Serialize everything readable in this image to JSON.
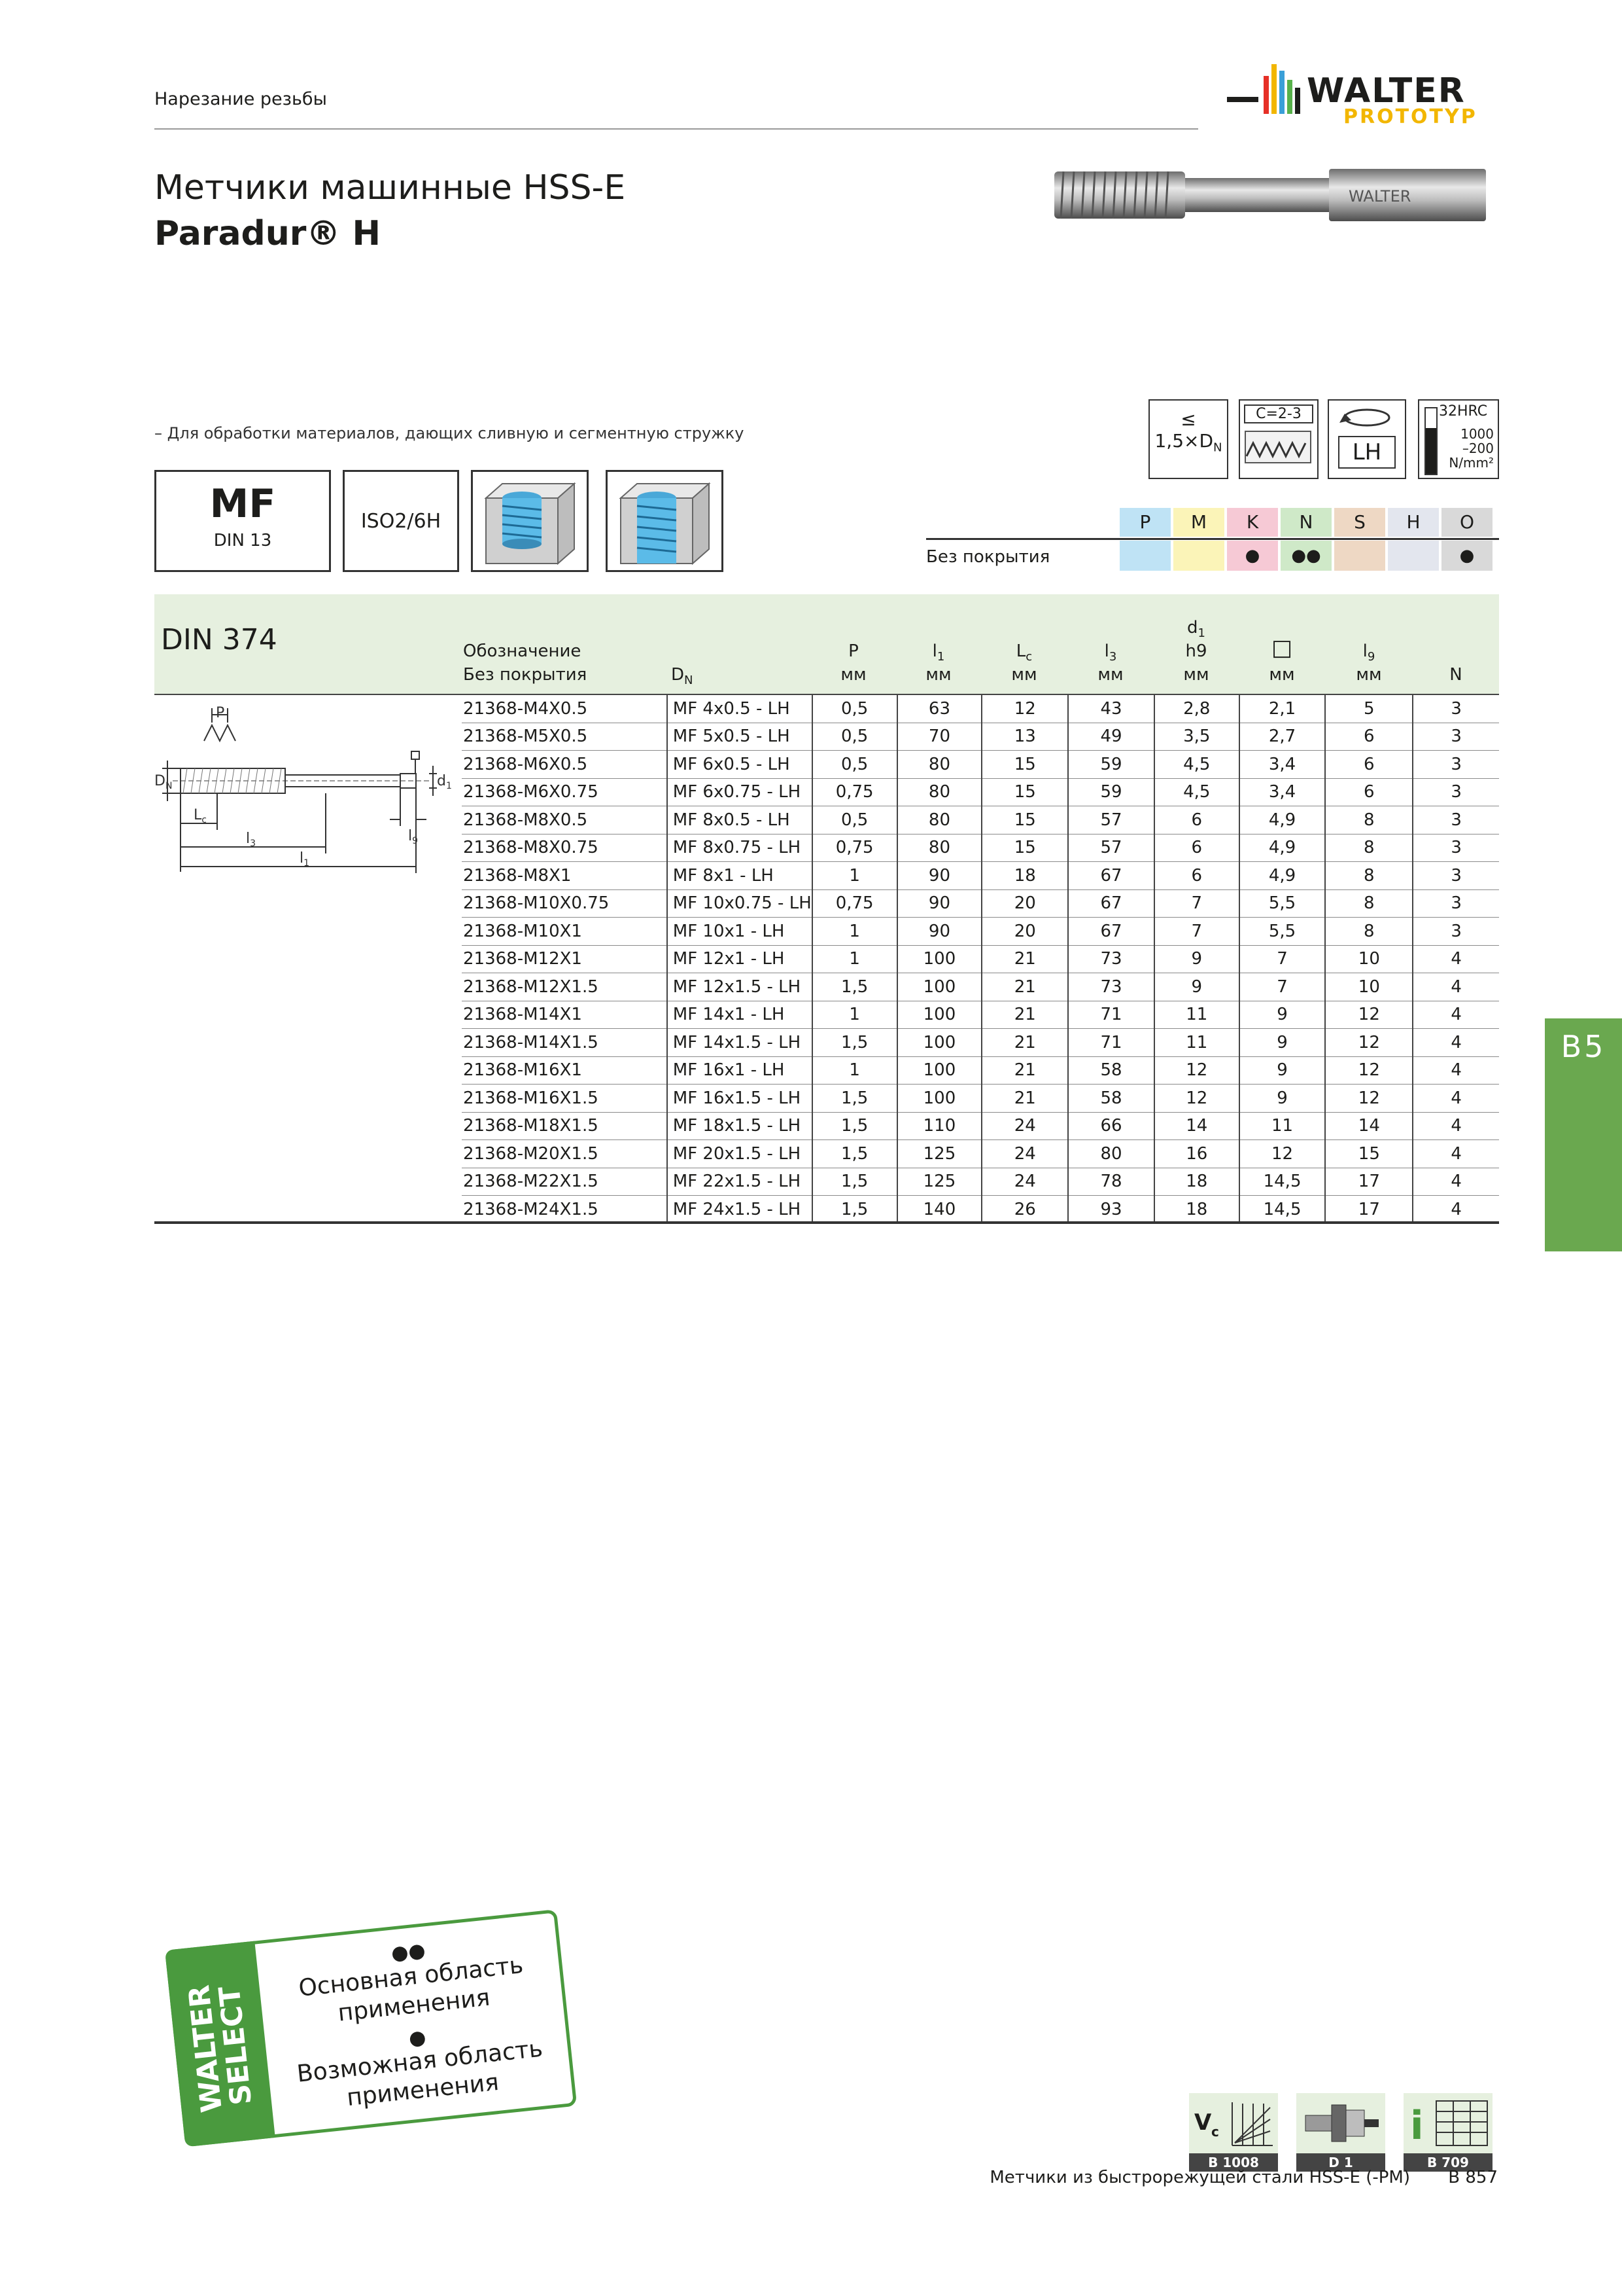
{
  "header": {
    "section": "Нарезание резьбы",
    "brand_top": "WALTER",
    "brand_bottom": "PROTOTYP",
    "tool_brand": "WALTER"
  },
  "product": {
    "title": "Метчики машинные HSS-E",
    "subtitle": "Paradur® H"
  },
  "usage_note": "– Для обработки материалов, дающих сливную и сегментную стружку",
  "feature_boxes": {
    "thread_type": "MF",
    "thread_norm": "DIN 13",
    "tolerance": "ISO2/6H"
  },
  "icons": {
    "depth_symbol": "≤",
    "depth_value": "1,5×D",
    "depth_sub": "N",
    "chamfer": "C=2-3",
    "direction": "LH",
    "hardness_top": "32HRC",
    "hardness_mid1": "1000",
    "hardness_mid2": "–200",
    "hardness_unit": "N/mm²"
  },
  "materials": {
    "groups": [
      {
        "code": "P",
        "color": "#bfe3f5",
        "dot": ""
      },
      {
        "code": "M",
        "color": "#fbf4b8",
        "dot": ""
      },
      {
        "code": "K",
        "color": "#f6c9d5",
        "dot": "●"
      },
      {
        "code": "N",
        "color": "#cfe9c8",
        "dot": "●●"
      },
      {
        "code": "S",
        "color": "#eed8c4",
        "dot": ""
      },
      {
        "code": "H",
        "color": "#e3e6ee",
        "dot": ""
      },
      {
        "code": "O",
        "color": "#d9d9d9",
        "dot": "●"
      }
    ],
    "coating_label": "Без покрытия"
  },
  "table": {
    "standard": "DIN 374",
    "headers": {
      "designation": "Обозначение",
      "designation_sub": "Без покрытия",
      "dn": "D",
      "dn_sub": "N",
      "p": "P",
      "l1": "l",
      "l1_sub": "1",
      "lc": "L",
      "lc_sub": "c",
      "l3": "l",
      "l3_sub": "3",
      "d1": "d",
      "d1_sub": "1",
      "d1_tol": "h9",
      "square": "□",
      "l9": "l",
      "l9_sub": "9",
      "n": "N",
      "unit": "мм"
    },
    "rows": [
      [
        "21368-M4X0.5",
        "MF 4x0.5 - LH",
        "0,5",
        "63",
        "12",
        "43",
        "2,8",
        "2,1",
        "5",
        "3"
      ],
      [
        "21368-M5X0.5",
        "MF 5x0.5 - LH",
        "0,5",
        "70",
        "13",
        "49",
        "3,5",
        "2,7",
        "6",
        "3"
      ],
      [
        "21368-M6X0.5",
        "MF 6x0.5 - LH",
        "0,5",
        "80",
        "15",
        "59",
        "4,5",
        "3,4",
        "6",
        "3"
      ],
      [
        "21368-M6X0.75",
        "MF 6x0.75 - LH",
        "0,75",
        "80",
        "15",
        "59",
        "4,5",
        "3,4",
        "6",
        "3"
      ],
      [
        "21368-M8X0.5",
        "MF 8x0.5 - LH",
        "0,5",
        "80",
        "15",
        "57",
        "6",
        "4,9",
        "8",
        "3"
      ],
      [
        "21368-M8X0.75",
        "MF 8x0.75 - LH",
        "0,75",
        "80",
        "15",
        "57",
        "6",
        "4,9",
        "8",
        "3"
      ],
      [
        "21368-M8X1",
        "MF 8x1 - LH",
        "1",
        "90",
        "18",
        "67",
        "6",
        "4,9",
        "8",
        "3"
      ],
      [
        "21368-M10X0.75",
        "MF 10x0.75 - LH",
        "0,75",
        "90",
        "20",
        "67",
        "7",
        "5,5",
        "8",
        "3"
      ],
      [
        "21368-M10X1",
        "MF 10x1 - LH",
        "1",
        "90",
        "20",
        "67",
        "7",
        "5,5",
        "8",
        "3"
      ],
      [
        "21368-M12X1",
        "MF 12x1 - LH",
        "1",
        "100",
        "21",
        "73",
        "9",
        "7",
        "10",
        "4"
      ],
      [
        "21368-M12X1.5",
        "MF 12x1.5 - LH",
        "1,5",
        "100",
        "21",
        "73",
        "9",
        "7",
        "10",
        "4"
      ],
      [
        "21368-M14X1",
        "MF 14x1 - LH",
        "1",
        "100",
        "21",
        "71",
        "11",
        "9",
        "12",
        "4"
      ],
      [
        "21368-M14X1.5",
        "MF 14x1.5 - LH",
        "1,5",
        "100",
        "21",
        "71",
        "11",
        "9",
        "12",
        "4"
      ],
      [
        "21368-M16X1",
        "MF 16x1 - LH",
        "1",
        "100",
        "21",
        "58",
        "12",
        "9",
        "12",
        "4"
      ],
      [
        "21368-M16X1.5",
        "MF 16x1.5 - LH",
        "1,5",
        "100",
        "21",
        "58",
        "12",
        "9",
        "12",
        "4"
      ],
      [
        "21368-M18X1.5",
        "MF 18x1.5 - LH",
        "1,5",
        "110",
        "24",
        "66",
        "14",
        "11",
        "14",
        "4"
      ],
      [
        "21368-M20X1.5",
        "MF 20x1.5 - LH",
        "1,5",
        "125",
        "24",
        "80",
        "16",
        "12",
        "15",
        "4"
      ],
      [
        "21368-M22X1.5",
        "MF 22x1.5 - LH",
        "1,5",
        "125",
        "24",
        "78",
        "18",
        "14,5",
        "17",
        "4"
      ],
      [
        "21368-M24X1.5",
        "MF 24x1.5 - LH",
        "1,5",
        "140",
        "26",
        "93",
        "18",
        "14,5",
        "17",
        "4"
      ]
    ]
  },
  "diagram_labels": {
    "pitch": "P",
    "dn": "D",
    "dn_sub": "N",
    "lc": "L",
    "lc_sub": "c",
    "l3": "l",
    "l3_sub": "3",
    "l1": "l",
    "l1_sub": "1",
    "d1": "d",
    "d1_sub": "1",
    "l9": "l",
    "l9_sub": "9"
  },
  "side_tab": "B5",
  "walter_select": {
    "brand_line1": "WALTER",
    "brand_line2": "SELECT",
    "dots_main": "●●",
    "main_label": "Основная область применения",
    "dot_possible": "●",
    "possible_label": "Возможная область применения"
  },
  "references": [
    {
      "label": "B 1008",
      "icon": "cutting-speed-chart-icon"
    },
    {
      "label": "D 1",
      "icon": "tool-holder-icon"
    },
    {
      "label": "B 709",
      "icon": "info-table-icon"
    }
  ],
  "footer": {
    "text": "Метчики из быстрорежущей стали HSS-E (-PM)",
    "page": "B 857"
  }
}
